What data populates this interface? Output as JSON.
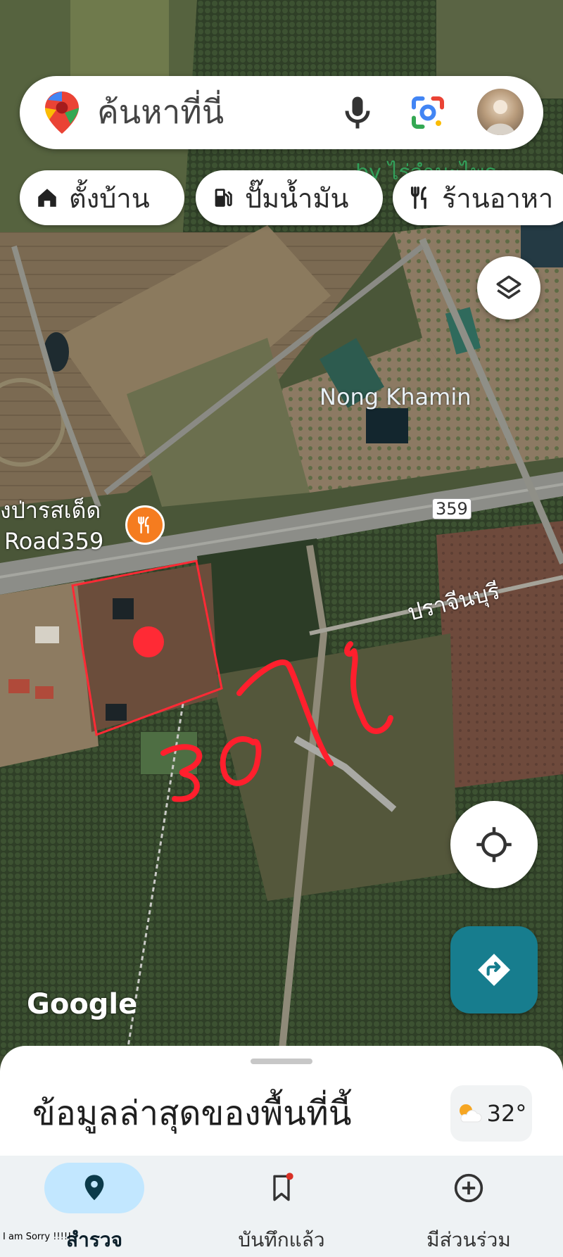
{
  "search": {
    "placeholder": "ค้นหาที่นี่"
  },
  "chips": [
    {
      "label": "ตั้งบ้าน",
      "icon": "home-icon"
    },
    {
      "label": "ปั๊มน้ำมัน",
      "icon": "gas-station-icon"
    },
    {
      "label": "ร้านอาหา",
      "icon": "restaurant-icon"
    }
  ],
  "map": {
    "labels": {
      "nong_khamin": "Nong Khamin",
      "restaurant_line1": "งป่ารสเด็ด",
      "restaurant_line2": "Road359",
      "road_shield": "359",
      "prachinburi": "ปราจีนบุรี",
      "top_partial": "by ไร่ลำมะไพร",
      "handwritten_note": "30 ไร่"
    },
    "watermark": "Google",
    "annotation_color": "#ff1f2d"
  },
  "sheet": {
    "title": "ข้อมูลล่าสุดของพื้นที่นี้",
    "temperature": "32°",
    "weather_icon": "partly-sunny-icon"
  },
  "nav": {
    "items": [
      {
        "label": "สำรวจ",
        "icon": "explore-pin-icon",
        "active": true
      },
      {
        "label": "บันทึกแล้ว",
        "icon": "bookmark-icon",
        "active": false
      },
      {
        "label": "มีส่วนร่วม",
        "icon": "add-circle-icon",
        "active": false
      }
    ]
  },
  "footer_note": "I am Sorry !!!!!"
}
